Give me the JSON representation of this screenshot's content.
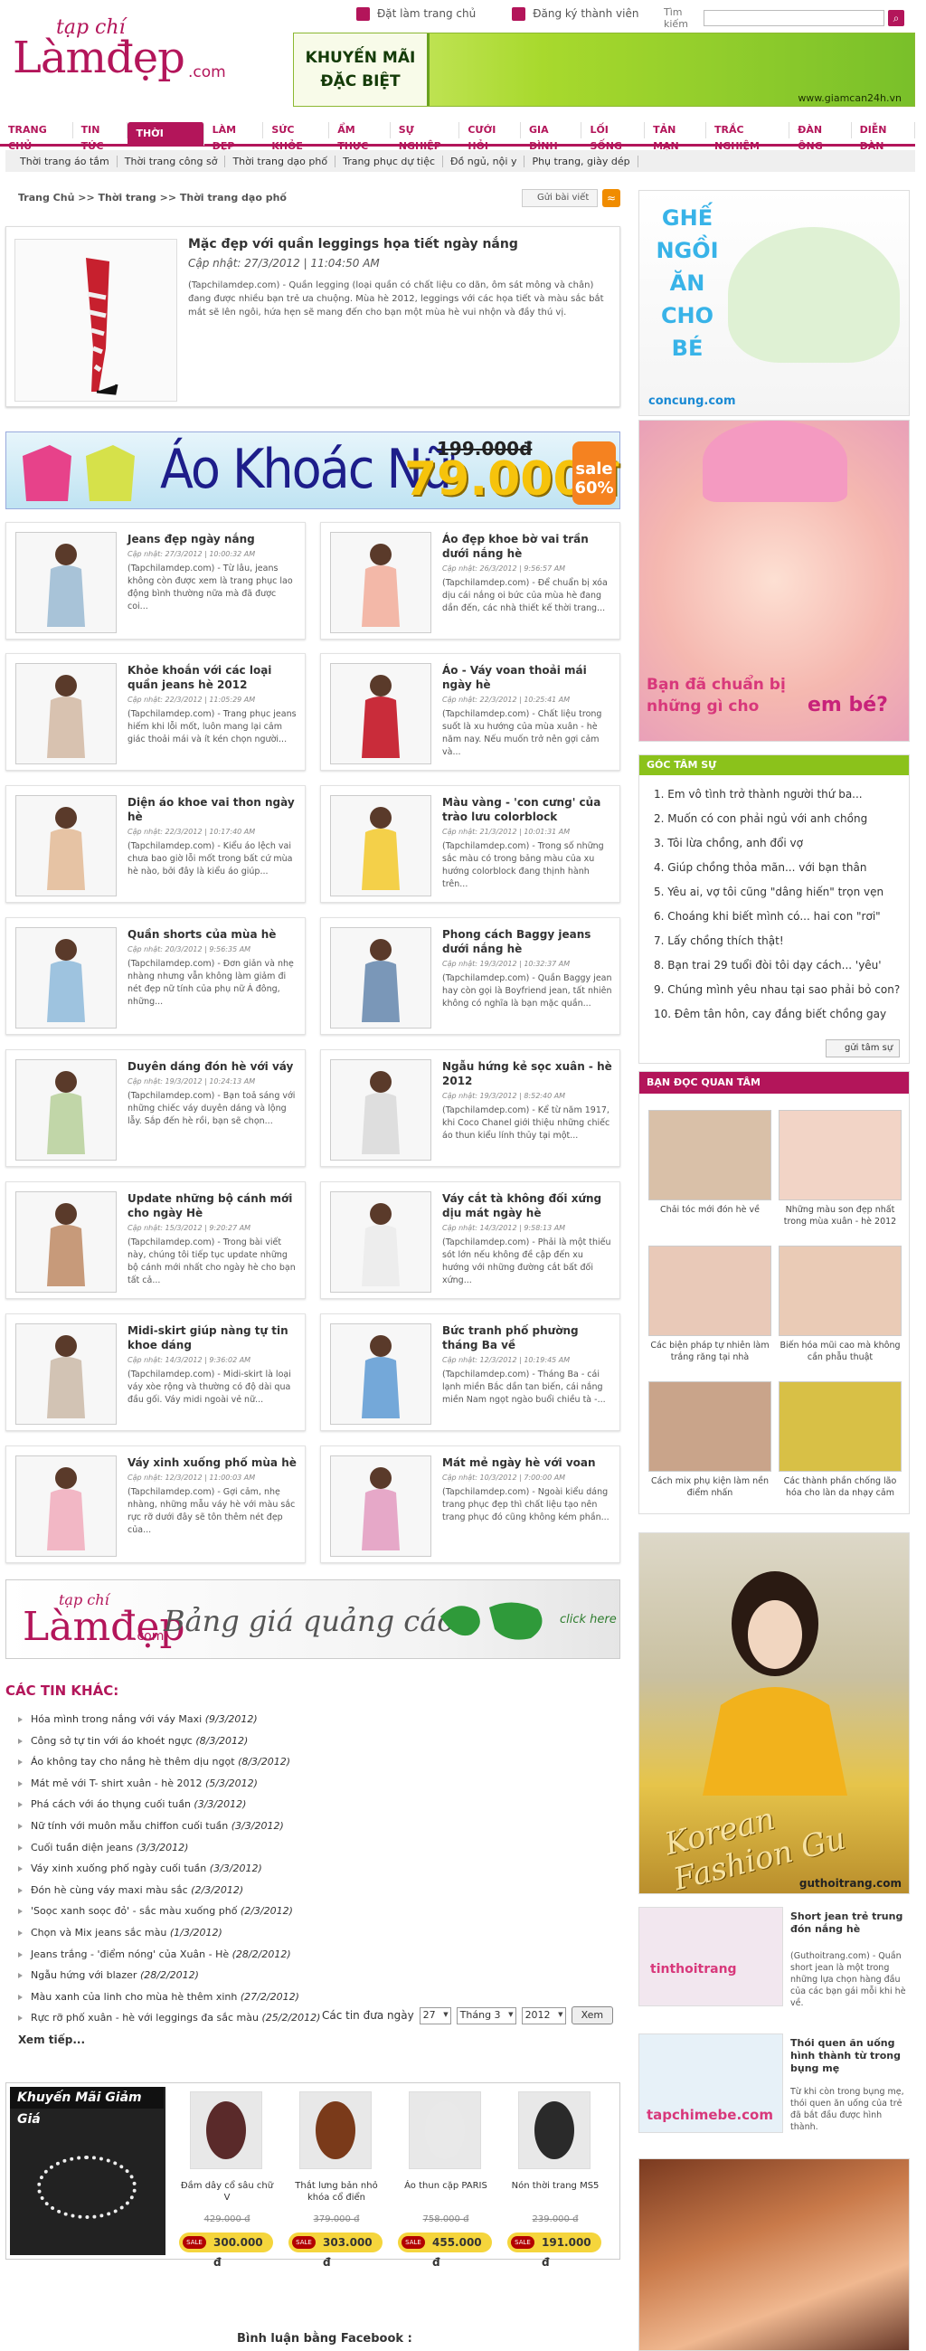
{
  "header": {
    "logo_small": "tạp chí",
    "logo_big": "Làmđẹp",
    "logo_com": ".com",
    "home_link": "Đặt làm trang chủ",
    "register_link": "Đăng ký thành viên",
    "search_label": "Tìm kiếm",
    "search_value": "",
    "banner_line1": "KHUYẾN MÃI",
    "banner_line2": "ĐẶC BIỆT",
    "banner_url": "www.giamcan24h.vn"
  },
  "nav": {
    "items": [
      "TRANG CHỦ",
      "TIN TỨC",
      "THỜI TRANG",
      "LÀM ĐẸP",
      "SỨC KHỎE",
      "ẨM THỰC",
      "SỰ NGHIỆP",
      "CƯỚI HỎI",
      "GIA ĐÌNH",
      "LỐI SỐNG",
      "TẢN MẠN",
      "TRẮC NGHIỆM",
      "ĐÀN ÔNG",
      "DIỄN ĐÀN"
    ],
    "active_index": 2,
    "sub_items": [
      "Thời trang áo tắm",
      "Thời trang công sở",
      "Thời trang dạo phố",
      "Trang phục dự tiệc",
      "Đồ ngủ, nội y",
      "Phụ trang, giày dép"
    ]
  },
  "breadcrumb": "Trang Chủ >> Thời trang >> Thời trang dạo phố",
  "send_button": "Gửi bài viết",
  "rss_icon": "rss-icon",
  "featured": {
    "title": "Mặc đẹp với quần leggings họa tiết ngày nắng",
    "date": "Cập nhật: 27/3/2012 | 11:04:50 AM",
    "desc": "(Tapchilamdep.com) - Quần legging (loại quần có chất liệu co dãn, ôm sát mông và chân) đang được nhiều bạn trẻ ưa chuộng. Mùa hè 2012, leggings với các họa tiết và màu sắc bắt mắt sẽ lên ngôi, hứa hẹn sẽ mang đến cho bạn một mùa hè vui nhộn và đầy thú vị."
  },
  "promo": {
    "text": "Áo Khoác Nữ",
    "old_price": "199.000đ",
    "new_price": "79.000đ",
    "sale": "sale 60%"
  },
  "articles": [
    {
      "title": "Jeans đẹp ngày nắng",
      "date": "Cập nhật: 27/3/2012 | 10:00:32 AM",
      "desc": "(Tapchilamdep.com) - Từ lâu, jeans không còn được xem là trang phục lao động bình thường nữa mà đã được coi..."
    },
    {
      "title": "Áo đẹp khoe bờ vai trần dưới nắng hè",
      "date": "Cập nhật: 26/3/2012 | 9:56:57 AM",
      "desc": "(Tapchilamdep.com) - Để chuẩn bị xóa dịu cái nắng oi bức của mùa hè đang dần đến, các nhà thiết kế thời trang..."
    },
    {
      "title": "Khỏe khoắn với các loại quần jeans hè 2012",
      "date": "Cập nhật: 22/3/2012 | 11:05:29 AM",
      "desc": "(Tapchilamdep.com) - Trang phục jeans hiếm khi lỗi mốt, luôn mang lại cảm giác thoải mái và ít kén chọn người..."
    },
    {
      "title": "Áo - Váy voan thoải mái ngày hè",
      "date": "Cập nhật: 22/3/2012 | 10:25:41 AM",
      "desc": "(Tapchilamdep.com) - Chất liệu trong suốt là xu hướng của mùa xuân - hè năm nay. Nếu muốn trở nên gợi cảm và..."
    },
    {
      "title": "Diện áo khoe vai thon ngày hè",
      "date": "Cập nhật: 22/3/2012 | 10:17:40 AM",
      "desc": "(Tapchilamdep.com) - Kiểu áo lệch vai chưa bao giờ lỗi mốt trong bất cứ mùa hè nào, bởi đây là kiểu áo giúp..."
    },
    {
      "title": "Màu vàng - 'con cưng' của trào lưu colorblock",
      "date": "Cập nhật: 21/3/2012 | 10:01:31 AM",
      "desc": "(Tapchilamdep.com) - Trong số những sắc màu có trong bảng màu của xu hướng colorblock đang thịnh hành trên..."
    },
    {
      "title": "Quần shorts của mùa hè",
      "date": "Cập nhật: 20/3/2012 | 9:56:35 AM",
      "desc": "(Tapchilamdep.com) - Đơn giản và nhẹ nhàng nhưng vẫn không làm giảm đi nét đẹp nữ tính của phụ nữ Á đông, những..."
    },
    {
      "title": "Phong cách Baggy jeans dưới nắng hè",
      "date": "Cập nhật: 19/3/2012 | 10:32:37 AM",
      "desc": "(Tapchilamdep.com) - Quần Baggy jean hay còn gọi là Boyfriend jean, tất nhiên không có nghĩa là bạn mặc quần..."
    },
    {
      "title": "Duyên dáng đón hè với váy",
      "date": "Cập nhật: 19/3/2012 | 10:24:13 AM",
      "desc": "(Tapchilamdep.com) - Bạn toả sáng với những chiếc váy duyên dáng và lộng lẫy. Sắp đến hè rồi, bạn sẽ chọn..."
    },
    {
      "title": "Ngẫu hứng kẻ sọc xuân - hè 2012",
      "date": "Cập nhật: 19/3/2012 | 8:52:40 AM",
      "desc": "(Tapchilamdep.com) - Kể từ năm 1917, khi Coco Chanel giới thiệu những chiếc áo thun kiểu lính thủy tại một..."
    },
    {
      "title": "Update những bộ cánh mới cho ngày Hè",
      "date": "Cập nhật: 15/3/2012 | 9:20:27 AM",
      "desc": "(Tapchilamdep.com) - Trong bài viết này, chúng tôi tiếp tục update những bộ cánh mới nhất cho ngày hè cho bạn tất cả..."
    },
    {
      "title": "Váy cắt tà không đối xứng dịu mát ngày hè",
      "date": "Cập nhật: 14/3/2012 | 9:58:13 AM",
      "desc": "(Tapchilamdep.com) - Phải là một thiếu sót lớn nếu không đề cập đến xu hướng với những đường cắt bất đối xứng..."
    },
    {
      "title": "Midi-skirt giúp nàng tự tin khoe dáng",
      "date": "Cập nhật: 14/3/2012 | 9:36:02 AM",
      "desc": "(Tapchilamdep.com) - Midi-skirt là loại váy xòe rộng và thường có độ dài qua đầu gối. Váy midi ngoài vẻ nữ..."
    },
    {
      "title": "Bức tranh phố phường tháng Ba về",
      "date": "Cập nhật: 12/3/2012 | 10:19:45 AM",
      "desc": "(Tapchilamdep.com) - Tháng Ba - cái lạnh miền Bắc dần tan biến, cái nắng miền Nam ngọt ngào buổi chiều tà -..."
    },
    {
      "title": "Váy xinh xuống phố mùa hè",
      "date": "Cập nhật: 12/3/2012 | 11:00:03 AM",
      "desc": "(Tapchilamdep.com) - Gợi cảm, nhẹ nhàng, những mẫu váy hè với màu sắc rực rỡ dưới đây sẽ tôn thêm nét đẹp của..."
    },
    {
      "title": "Mát mẻ ngày hè với voan",
      "date": "Cập nhật: 10/3/2012 | 7:00:00 AM",
      "desc": "(Tapchilamdep.com) - Ngoài kiểu dáng trang phục đẹp thì chất liệu tạo nên trang phục đó cũng không kém phần..."
    }
  ],
  "adstrip": {
    "logo_small": "tạp chí",
    "logo_big": "Làmđẹp",
    "logo_com": ".com",
    "text": "Bảng giá quảng cáo",
    "click": "click here"
  },
  "other": {
    "heading": "CÁC TIN KHÁC:",
    "items": [
      {
        "t": "Hóa mình trong nắng với váy Maxi",
        "d": "(9/3/2012)"
      },
      {
        "t": "Công sở tự tin với áo khoét ngực",
        "d": "(8/3/2012)"
      },
      {
        "t": "Áo không tay cho nắng hè thêm dịu ngọt",
        "d": "(8/3/2012)"
      },
      {
        "t": "Mát mẻ với T- shirt xuân - hè 2012",
        "d": "(5/3/2012)"
      },
      {
        "t": "Phá cách với áo thụng cuối tuần",
        "d": "(3/3/2012)"
      },
      {
        "t": "Nữ tính với muôn mẫu chiffon cuối tuần",
        "d": "(3/3/2012)"
      },
      {
        "t": "Cuối tuần diện jeans",
        "d": "(3/3/2012)"
      },
      {
        "t": "Váy xinh xuống phố ngày cuối tuần",
        "d": "(3/3/2012)"
      },
      {
        "t": "Đón hè cùng váy maxi màu sắc",
        "d": "(2/3/2012)"
      },
      {
        "t": "'Soọc xanh soọc đỏ' - sắc màu xuống phố",
        "d": "(2/3/2012)"
      },
      {
        "t": "Chọn và Mix jeans sắc màu",
        "d": "(1/3/2012)"
      },
      {
        "t": "Jeans trắng - 'điểm nóng' của Xuân - Hè",
        "d": "(28/2/2012)"
      },
      {
        "t": "Ngẫu hứng với blazer",
        "d": "(28/2/2012)"
      },
      {
        "t": "Màu xanh của linh cho mùa hè thêm xinh",
        "d": "(27/2/2012)"
      },
      {
        "t": "Rực rỡ phố xuân - hè với leggings đa sắc màu",
        "d": "(25/2/2012)"
      }
    ],
    "more": "Xem tiếp...",
    "filter_label": "Các tin đưa ngày",
    "day": "27",
    "month": "Tháng 3",
    "year": "2012",
    "go": "Xem"
  },
  "km": {
    "label": "Khuyến Mãi Giảm Giá",
    "products": [
      {
        "name": "Đầm dây cổ sâu chữ V",
        "old": "429.000 đ",
        "price": "300.000 đ",
        "sale": "SALE"
      },
      {
        "name": "Thắt lưng bản nhỏ khóa cổ điển",
        "old": "379.000 đ",
        "price": "303.000 đ",
        "sale": "SALE"
      },
      {
        "name": "Áo thun cặp PARIS",
        "old": "758.000 đ",
        "price": "455.000 đ",
        "sale": "SALE"
      },
      {
        "name": "Nón thời trang MS5",
        "old": "239.000 đ",
        "price": "191.000 đ",
        "sale": "SALE"
      }
    ]
  },
  "facebook_label": "Bình luận bằng Facebook :",
  "right": {
    "concung_text": "GHẾ NGỒI ĂN CHO BÉ",
    "concung_url": "concung.com",
    "baby_line1": "Bạn đã chuẩn bị",
    "baby_line2": "những gì cho",
    "baby_line3": "em bé?",
    "goc_heading": "GÓC TÂM SỰ",
    "goc_items": [
      "1. Em vô tình trở thành người thứ ba...",
      "2. Muốn có con phải ngủ với anh chồng",
      "3. Tôi lừa chồng, anh đổi vợ",
      "4. Giúp chồng thỏa mãn... với bạn thân",
      "5. Yêu ai, vợ tôi cũng \"dâng hiến\" trọn vẹn",
      "6. Choáng khi biết mình có... hai con \"rơi\"",
      "7. Lấy chồng thích thật!",
      "8. Bạn trai 29 tuổi đòi tôi dạy cách... 'yêu'",
      "9. Chúng mình yêu nhau tại sao phải bỏ con?",
      "10. Đêm tân hôn, cay đắng biết chồng gay"
    ],
    "goc_button": "gửi tâm sự",
    "bd_heading": "BẠN ĐỌC QUAN TÂM",
    "bd_items": [
      "Chải tóc mới đón hè về",
      "Những màu son đẹp nhất trong mùa xuân - hè 2012",
      "Các biện pháp tự nhiên làm trắng răng tại nhà",
      "Biến hóa mũi cao mà không cần phẫu thuật",
      "Cách mix phụ kiện làm nền điểm nhấn",
      "Các thành phần chống lão hóa cho làn da nhạy cảm"
    ],
    "korean_text": "Korean Fashion Gu",
    "korean_url": "guthoitrang.com",
    "card1_title": "Short jean trẻ trung đón nắng hè",
    "card1_desc": "(Guthoitrang.com) - Quần short jean là một trong những lựa chọn hàng đầu của các bạn gái mỗi khi hè về.",
    "card1_logo": "tinthoitrang",
    "card2_title": "Thói quen ăn uống hình thành từ trong bụng mẹ",
    "card2_desc": "Từ khi còn trong bụng mẹ, thói quen ăn uống của trẻ đã bắt đầu được hình thành.",
    "card2_logo": "tapchimebe.com"
  }
}
